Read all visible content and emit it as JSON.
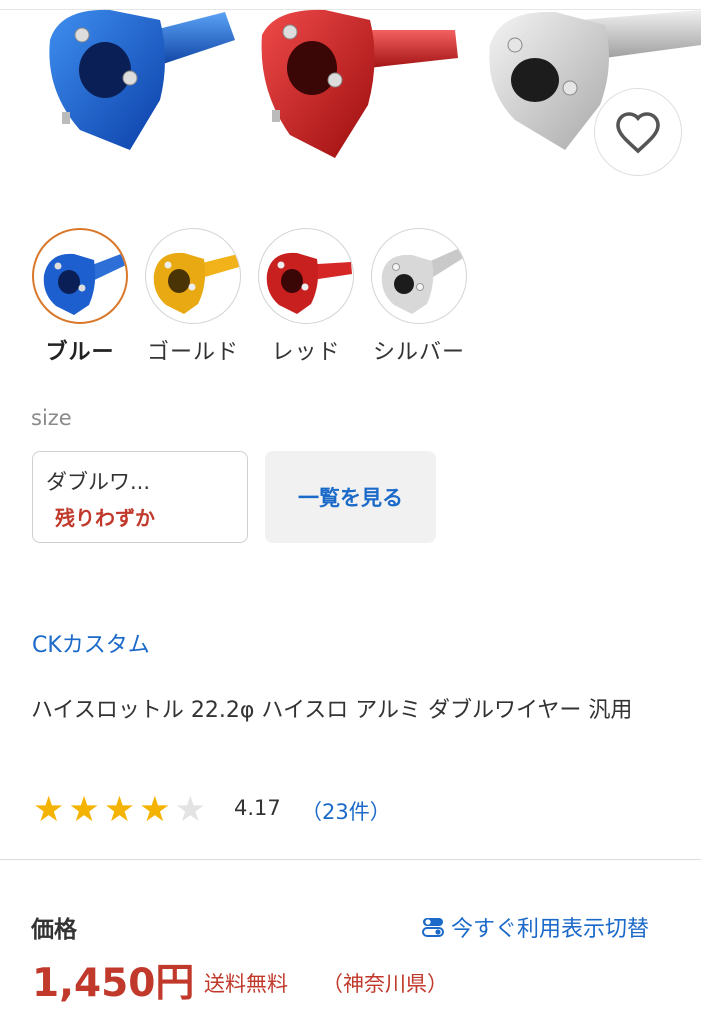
{
  "colors": {
    "accent_blue": "#1b6ac9",
    "price_red": "#c0392b",
    "star": "#f5b301",
    "selected_border": "#d9782a"
  },
  "hero": {
    "products": [
      "blue",
      "red",
      "silver"
    ],
    "favorite_icon": "heart-outline-icon"
  },
  "swatches": [
    {
      "label": "ブルー",
      "selected": true
    },
    {
      "label": "ゴールド",
      "selected": false
    },
    {
      "label": "レッド",
      "selected": false
    },
    {
      "label": "シルバー",
      "selected": false
    }
  ],
  "size": {
    "label": "size",
    "selected_value": "ダブルワ...",
    "stock_status": "残りわずか",
    "list_button": "一覧を見る"
  },
  "product": {
    "store_name": "CKカスタム",
    "title": "ハイスロットル 22.2φ ハイスロ アルミ ダブルワイヤー 汎用",
    "rating": {
      "stars_filled": 4,
      "stars_total": 5,
      "value": "4.17",
      "count": "（23件）"
    }
  },
  "price": {
    "label": "価格",
    "switch_link": "今すぐ利用表示切替",
    "switch_icon": "toggle-icon",
    "amount": "1,450円",
    "shipping": "送料無料",
    "region": "（神奈川県）"
  }
}
